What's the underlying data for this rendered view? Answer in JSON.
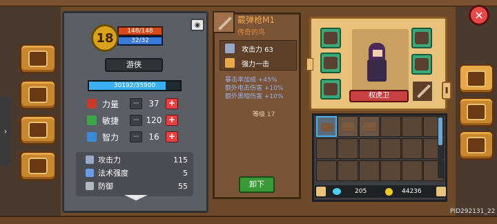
{
  "character": {
    "level": "18",
    "hp": "148/148",
    "mp": "32/32",
    "class_name": "游侠",
    "xp": "30192/35900",
    "xp_fraction": 0.84
  },
  "attributes": [
    {
      "label": "力量",
      "value": "37",
      "color": "#c83a2a"
    },
    {
      "label": "敏捷",
      "value": "120",
      "color": "#3aa848"
    },
    {
      "label": "智力",
      "value": "16",
      "color": "#3a8ad8"
    }
  ],
  "derived_stats": [
    {
      "label": "攻击力",
      "value": "115",
      "icon": "sword-icon"
    },
    {
      "label": "法术强度",
      "value": "5",
      "icon": "wand-icon"
    },
    {
      "label": "防御",
      "value": "55",
      "icon": "shield-icon"
    }
  ],
  "weapon": {
    "name": "霰弹枪M1",
    "quality": "传奇的鸟",
    "attack_label": "攻击力 63",
    "skill_label": "强力一击",
    "bonus_crit": "暴击率加成 +45%",
    "bonus_elec": "额外电击伤害 +10%",
    "bonus_dark": "额外黑暗伤害 +10%",
    "level_label": "等级 17",
    "unequip_label": "卸下"
  },
  "equipment": {
    "title_banner": "权虎卫"
  },
  "currency": {
    "gems": "205",
    "coins": "44236"
  },
  "footer": {
    "pid": "PID292131_22"
  },
  "colors": {
    "accent_gold": "#d9a21c",
    "hp_red": "#d84a1a",
    "mp_blue": "#3a7ad8",
    "xp_cyan": "#3ab0f0",
    "button_green": "#3a9a38",
    "close_red": "#e84848"
  }
}
